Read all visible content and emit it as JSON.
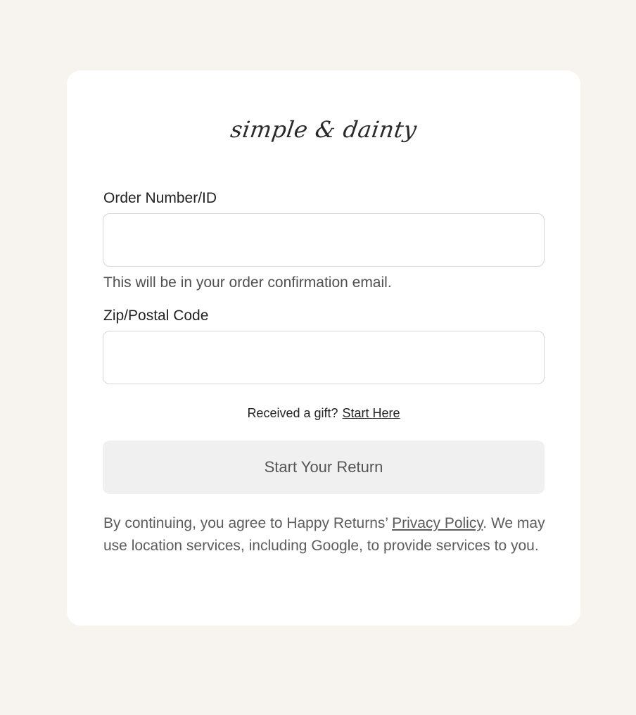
{
  "brand": {
    "logo_text": "simple & dainty"
  },
  "form": {
    "order": {
      "label": "Order Number/ID",
      "value": "",
      "hint": "This will be in your order confirmation email."
    },
    "zip": {
      "label": "Zip/Postal Code",
      "value": ""
    },
    "gift": {
      "prompt": "Received a gift?",
      "link": "Start Here"
    },
    "submit_label": "Start Your Return"
  },
  "legal": {
    "text_before": "By continuing, you agree to Happy Returns’ ",
    "privacy_link": "Privacy Policy",
    "text_after": ". We may use location services, including Google, to provide services to you."
  },
  "colors": {
    "page_background": "#f7f4f0",
    "card_background": "#ffffff",
    "button_background": "#f0f0f0",
    "input_border": "#d6d6d6"
  }
}
